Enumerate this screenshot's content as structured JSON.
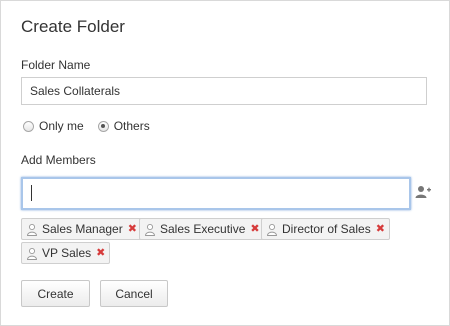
{
  "dialog": {
    "title": "Create Folder",
    "folder_name": {
      "label": "Folder Name",
      "value": "Sales Collaterals"
    },
    "visibility": {
      "options": [
        {
          "label": "Only me",
          "selected": false
        },
        {
          "label": "Others",
          "selected": true
        }
      ]
    },
    "add_members": {
      "label": "Add Members",
      "value": "",
      "icon": "add-user-icon"
    },
    "members": [
      {
        "label": "Sales Manager"
      },
      {
        "label": "Sales Executive"
      },
      {
        "label": "Director of Sales"
      },
      {
        "label": "VP Sales"
      }
    ],
    "remove_glyph": "✖",
    "buttons": {
      "create": "Create",
      "cancel": "Cancel"
    },
    "colors": {
      "focus_border": "#a9c6ea",
      "remove": "#d63b3b"
    }
  }
}
